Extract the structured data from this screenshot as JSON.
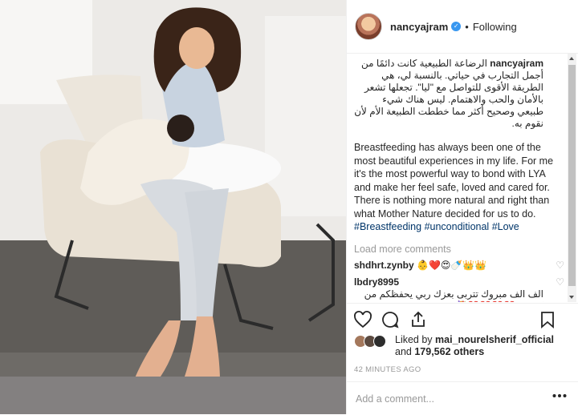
{
  "post": {
    "username": "nancyajram",
    "follow_status": "Following",
    "dot": "•",
    "verified_glyph": "✓"
  },
  "caption": {
    "user": "nancyajram",
    "arabic": "الرضاعة الطبيعية كانت دائمًا من أجمل التجارب في حياتي. بالنسبة لي، هي الطريقة الأقوى للتواصل مع \"ليا\". تجعلها تشعر بالأمان والحب والاهتمام. ليس هناك شيء طبيعي وصحيح أكثر مما خططت الطبيعة الأم لأن نقوم به.",
    "english": "Breastfeeding has always been one of the most beautiful experiences in my life. For me it's the most powerful way to bond with LYA and make her feel safe, loved and cared for. There is nothing more natural and right than what Mother Nature decided for us to do.",
    "tag1": "#Breastfeeding",
    "tag2": "#unconditional",
    "tag3": "#Love"
  },
  "comments": {
    "load_more": "Load more comments",
    "items": [
      {
        "user": "shdhrt.zynby",
        "text": "👶❤️😍🍼👑👑"
      },
      {
        "user": "lbdry8995",
        "text": "الف الف مبروك تتربى بعزك ربي يحفظكم من كل شر❤️❤️❤️❤️💐على من العراق"
      }
    ]
  },
  "likes": {
    "prefix": "Liked by",
    "user": "mai_nourelsherif_official",
    "and": "and",
    "count": "179,562 others"
  },
  "timestamp": "42 MINUTES AGO",
  "add_comment": {
    "placeholder": "Add a comment..."
  },
  "icons": [
    "heart-icon",
    "comment-icon",
    "share-icon",
    "bookmark-icon",
    "more-icon"
  ],
  "colors": {
    "link": "#003569",
    "verified": "#3897f0",
    "muted": "#999999"
  }
}
